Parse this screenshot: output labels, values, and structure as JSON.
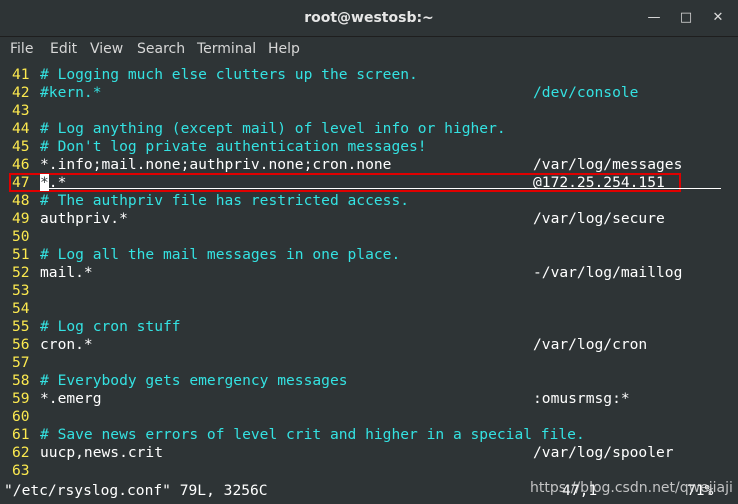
{
  "window": {
    "title": "root@westosb:~"
  },
  "menu": [
    "File",
    "Edit",
    "View",
    "Search",
    "Terminal",
    "Help"
  ],
  "lines": [
    {
      "n": "41",
      "text": "# Logging much else clutters up the screen.",
      "comment": true,
      "path": ""
    },
    {
      "n": "42",
      "text": "#kern.*",
      "comment": true,
      "path": "/dev/console",
      "pathComment": true
    },
    {
      "n": "43",
      "text": "",
      "comment": false,
      "path": ""
    },
    {
      "n": "44",
      "text": "# Log anything (except mail) of level info or higher.",
      "comment": true,
      "path": ""
    },
    {
      "n": "45",
      "text": "# Don't log private authentication messages!",
      "comment": true,
      "path": ""
    },
    {
      "n": "46",
      "text": "*.info;mail.none;authpriv.none;cron.none",
      "comment": false,
      "path": "/var/log/messages"
    },
    {
      "n": "47",
      "text": ".*",
      "cursor": "*",
      "comment": false,
      "path": "@172.25.254.151"
    },
    {
      "n": "48",
      "text": "# The authpriv file has restricted access.",
      "comment": true,
      "path": ""
    },
    {
      "n": "49",
      "text": "authpriv.*",
      "comment": false,
      "path": "/var/log/secure"
    },
    {
      "n": "50",
      "text": "",
      "comment": false,
      "path": ""
    },
    {
      "n": "51",
      "text": "# Log all the mail messages in one place.",
      "comment": true,
      "path": ""
    },
    {
      "n": "52",
      "text": "mail.*",
      "comment": false,
      "path": "-/var/log/maillog"
    },
    {
      "n": "53",
      "text": "",
      "comment": false,
      "path": ""
    },
    {
      "n": "54",
      "text": "",
      "comment": false,
      "path": ""
    },
    {
      "n": "55",
      "text": "# Log cron stuff",
      "comment": true,
      "path": ""
    },
    {
      "n": "56",
      "text": "cron.*",
      "comment": false,
      "path": "/var/log/cron"
    },
    {
      "n": "57",
      "text": "",
      "comment": false,
      "path": ""
    },
    {
      "n": "58",
      "text": "# Everybody gets emergency messages",
      "comment": true,
      "path": ""
    },
    {
      "n": "59",
      "text": "*.emerg",
      "comment": false,
      "path": ":omusrmsg:*"
    },
    {
      "n": "60",
      "text": "",
      "comment": false,
      "path": ""
    },
    {
      "n": "61",
      "text": "# Save news errors of level crit and higher in a special file.",
      "comment": true,
      "path": ""
    },
    {
      "n": "62",
      "text": "uucp,news.crit",
      "comment": false,
      "path": "/var/log/spooler"
    },
    {
      "n": "63",
      "text": "",
      "comment": false,
      "path": ""
    }
  ],
  "status": {
    "file": "\"/etc/rsyslog.conf\" 79L, 3256C",
    "position": "47,1",
    "percent": "71%"
  },
  "watermark": "https://blog.csdn.net/qwejiaji",
  "colors": {
    "background": "#2e3436",
    "line_numbers": "#fce94f",
    "comments": "#34e2e2",
    "highlight": "#e00000"
  }
}
